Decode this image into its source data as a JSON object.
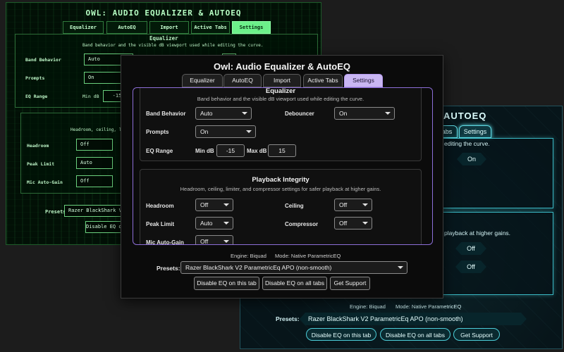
{
  "app_title": "Owl: Audio Equalizer & AutoEQ",
  "matrix_title": "OWL: AUDIO EQUALIZER & AUTOEQ",
  "teal_title_fragment": "AUTOEQ",
  "tabs": [
    "Equalizer",
    "AutoEQ",
    "Import",
    "Active Tabs",
    "Settings"
  ],
  "teal_tab_fragment": "abs",
  "active_tab": "Settings",
  "equalizer": {
    "heading": "Equalizer",
    "description": "Band behavior and the visible dB viewport used while editing the curve.",
    "band_behavior_label": "Band Behavior",
    "band_behavior_value": "Auto",
    "debouncer_label": "Debouncer",
    "debouncer_value": "On",
    "prompts_label": "Prompts",
    "prompts_value": "On",
    "eq_range_label": "EQ Range",
    "min_db_label": "Min dB",
    "min_db_value": "-15",
    "max_db_label": "Max dB",
    "max_db_value": "15"
  },
  "playback": {
    "heading": "Playback Integrity",
    "description": "Headroom, ceiling, limiter, and compressor settings for safer playback at higher gains.",
    "headroom_label": "Headroom",
    "headroom_value": "Off",
    "ceiling_label": "Ceiling",
    "ceiling_value": "Off",
    "peak_limit_label": "Peak Limit",
    "peak_limit_value": "Auto",
    "compressor_label": "Compressor",
    "compressor_value": "Off",
    "mic_autogain_label": "Mic Auto-Gain",
    "mic_autogain_value": "Off"
  },
  "matrix_fragments": {
    "headroom_sub": "Headroom, ceiling, limit",
    "presets_value": "Razer BlackShark V2 Paramet",
    "disable_tab": "Disable EQ on th"
  },
  "teal_fragments": {
    "eq_sub": "editing the curve.",
    "pb_sub": "playback at higher gains."
  },
  "footer": {
    "engine": "Engine: Biquad",
    "mode": "Mode: Native ParametricEQ",
    "presets_label": "Presets:",
    "presets_value": "Razer BlackShark V2 ParametricEq APO (non-smooth)",
    "disable_tab_button": "Disable EQ on this tab",
    "disable_all_button": "Disable EQ on all tabs",
    "support_button": "Get Support"
  },
  "colors": {
    "matrix_accent": "#6cf08a",
    "teal_accent": "#5fd9e3",
    "main_active_tab": "#c9b6f3",
    "scroll_border": "#8d6ed8"
  }
}
